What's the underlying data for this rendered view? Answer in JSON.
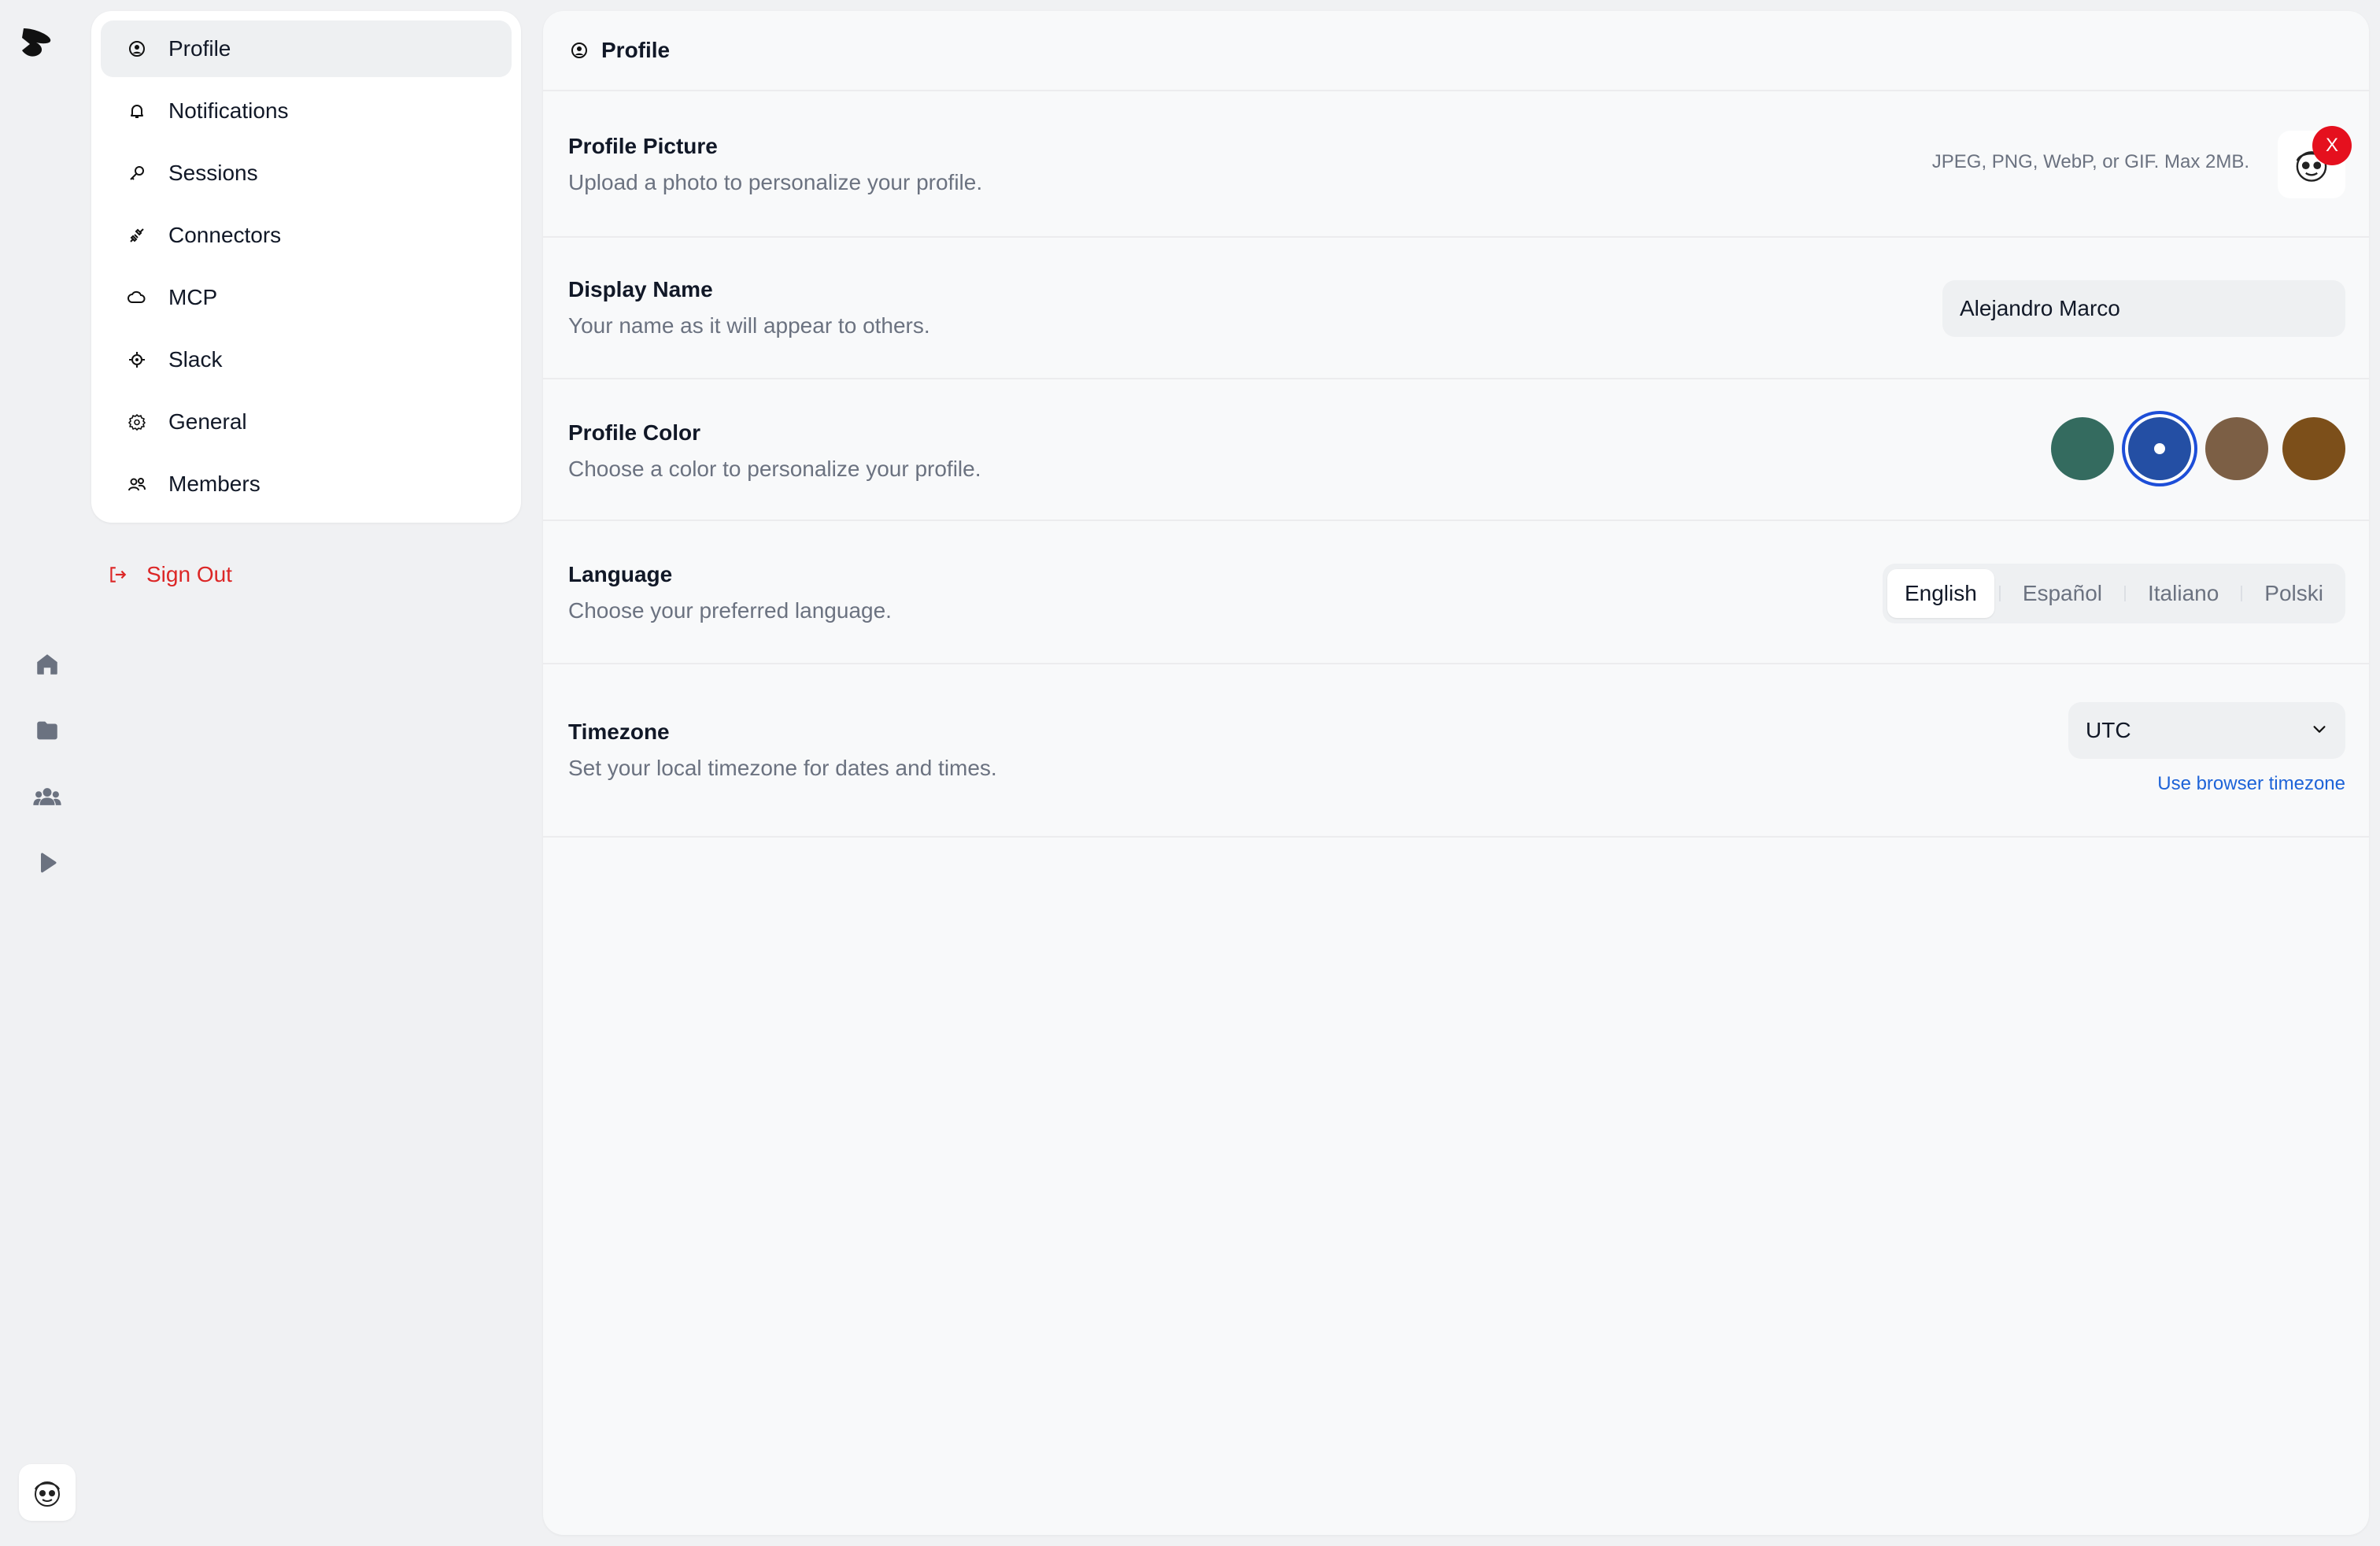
{
  "nav": {
    "items": [
      {
        "label": "Profile",
        "icon": "user-circle-icon",
        "active": true
      },
      {
        "label": "Notifications",
        "icon": "bell-icon",
        "active": false
      },
      {
        "label": "Sessions",
        "icon": "key-icon",
        "active": false
      },
      {
        "label": "Connectors",
        "icon": "plug-icon",
        "active": false
      },
      {
        "label": "MCP",
        "icon": "cloud-icon",
        "active": false
      },
      {
        "label": "Slack",
        "icon": "target-icon",
        "active": false
      },
      {
        "label": "General",
        "icon": "gear-icon",
        "active": false
      },
      {
        "label": "Members",
        "icon": "users-icon",
        "active": false
      }
    ],
    "sign_out": "Sign Out"
  },
  "rail": {
    "icons": [
      "home-icon",
      "folder-icon",
      "team-icon",
      "play-icon"
    ]
  },
  "header": {
    "title": "Profile"
  },
  "profile_picture": {
    "label": "Profile Picture",
    "description": "Upload a photo to personalize your profile.",
    "hint": "JPEG, PNG, WebP, or GIF. Max 2MB.",
    "remove_label": "X"
  },
  "display_name": {
    "label": "Display Name",
    "description": "Your name as it will appear to others.",
    "value": "Alejandro Marco"
  },
  "profile_color": {
    "label": "Profile Color",
    "description": "Choose a color to personalize your profile.",
    "options": [
      "#346b5f",
      "#244fa4",
      "#7c5f45",
      "#7c4f1a"
    ],
    "selected_index": 1
  },
  "language": {
    "label": "Language",
    "description": "Choose your preferred language.",
    "options": [
      "English",
      "Español",
      "Italiano",
      "Polski"
    ],
    "selected": "English"
  },
  "timezone": {
    "label": "Timezone",
    "description": "Set your local timezone for dates and times.",
    "value": "UTC",
    "browser_link": "Use browser timezone"
  },
  "colors": {
    "accent": "#1d4ed8",
    "danger": "#dc2626",
    "link": "#1d63d8"
  }
}
